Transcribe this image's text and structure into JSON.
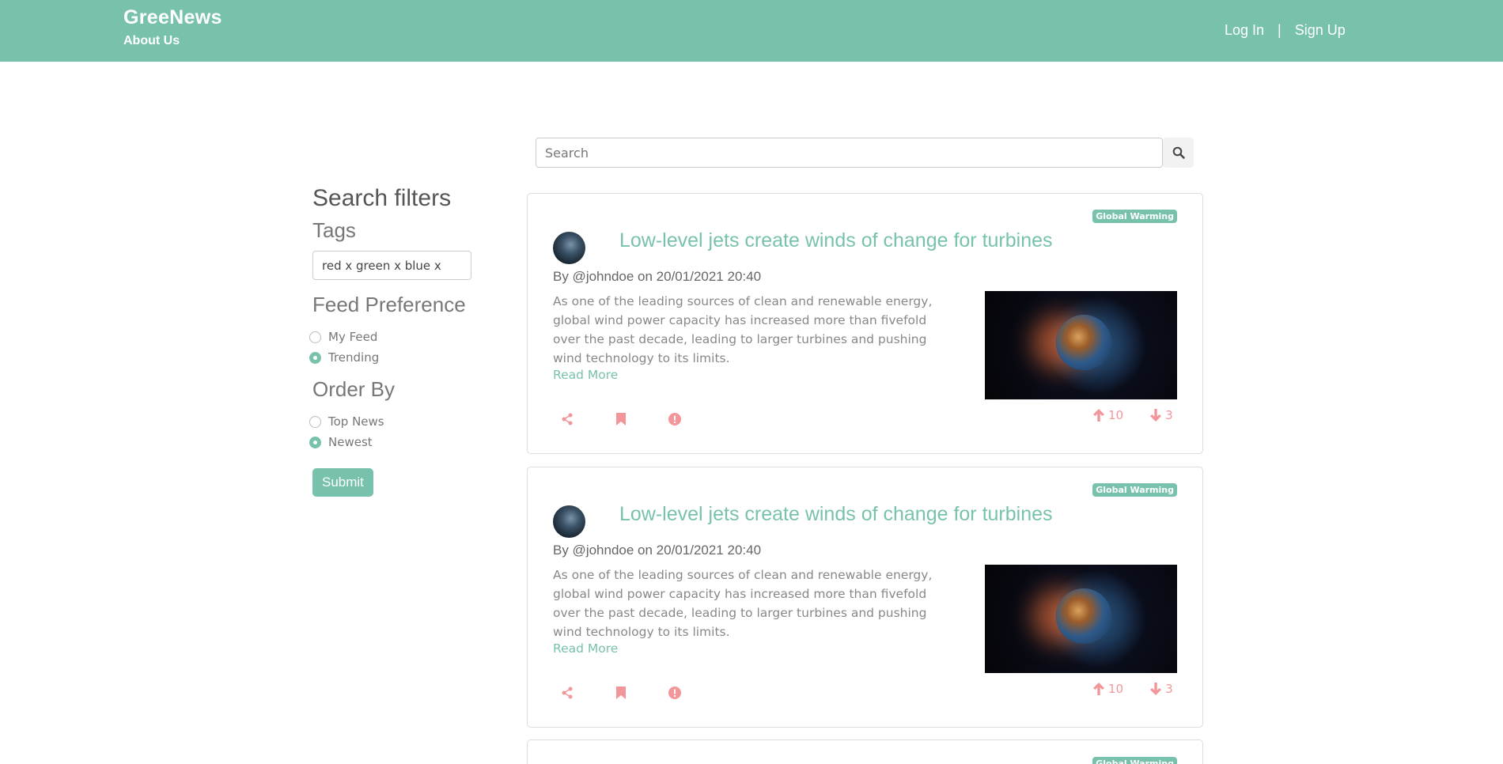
{
  "navbar": {
    "brand": "GreeNews",
    "about": "About Us",
    "login": "Log In",
    "separator": "|",
    "signup": "Sign Up"
  },
  "search": {
    "placeholder": "Search",
    "icon": "search-icon"
  },
  "filters": {
    "title": "Search filters",
    "tags_label": "Tags",
    "tags_value": "red x green x blue x",
    "feed_label": "Feed Preference",
    "feed_options": [
      {
        "label": "My Feed",
        "checked": false
      },
      {
        "label": "Trending",
        "checked": true
      }
    ],
    "order_label": "Order By",
    "order_options": [
      {
        "label": "Top News",
        "checked": false
      },
      {
        "label": "Newest",
        "checked": true
      }
    ],
    "submit": "Submit"
  },
  "posts": [
    {
      "tag": "Global Warming",
      "title": "Low-level jets create winds of change for turbines",
      "byline": "By @johndoe on 20/01/2021 20:40",
      "excerpt": "As one of the leading sources of clean and renewable energy, global wind power capacity has increased more than fivefold over the past decade, leading to larger turbines and pushing wind technology to its limits.",
      "read_more": "Read More",
      "upvotes": "10",
      "downvotes": "3"
    },
    {
      "tag": "Global Warming",
      "title": "Low-level jets create winds of change for turbines",
      "byline": "By @johndoe on 20/01/2021 20:40",
      "excerpt": "As one of the leading sources of clean and renewable energy, global wind power capacity has increased more than fivefold over the past decade, leading to larger turbines and pushing wind technology to its limits.",
      "read_more": "Read More",
      "upvotes": "10",
      "downvotes": "3"
    },
    {
      "tag": "Global Warming"
    }
  ],
  "colors": {
    "primary": "#78c2ad",
    "danger": "#f3969a"
  }
}
